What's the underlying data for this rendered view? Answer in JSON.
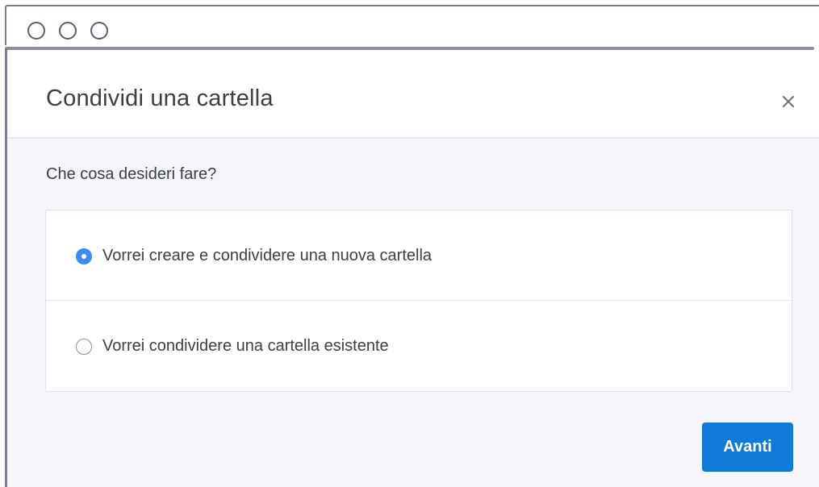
{
  "dialog": {
    "title": "Condividi una cartella",
    "close_icon": "close-icon",
    "question": "Che cosa desideri fare?",
    "options": [
      {
        "label": "Vorrei creare e condividere una nuova cartella",
        "selected": true
      },
      {
        "label": "Vorrei condividere una cartella esistente",
        "selected": false
      }
    ],
    "next_label": "Avanti"
  },
  "colors": {
    "accent": "#0f7bd6",
    "radio_selected": "#3b8ced",
    "body_bg": "#f4f6f9",
    "text": "#3c3f44"
  }
}
